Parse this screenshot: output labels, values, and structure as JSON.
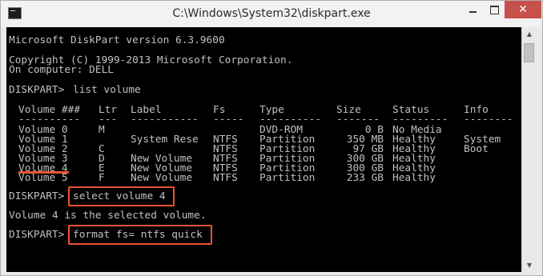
{
  "window": {
    "title": "C:\\Windows\\System32\\diskpart.exe",
    "icon": "console-app-icon",
    "controls": {
      "minimize": "minimize",
      "maximize": "maximize",
      "close": "✕"
    }
  },
  "console": {
    "version_line": "Microsoft DiskPart version 6.3.9600",
    "copyright_line": "Copyright (C) 1999-2013 Microsoft Corporation.",
    "computer_line": "On computer: DELL",
    "prompt": "DISKPART>",
    "command1": "list volume",
    "table": {
      "headers": [
        "Volume ###",
        "Ltr",
        "Label",
        "Fs",
        "Type",
        "Size",
        "Status",
        "Info"
      ],
      "separators": [
        "----------",
        "---",
        "-----------",
        "-----",
        "----------",
        "-------",
        "---------",
        "--------"
      ],
      "rows": [
        [
          "Volume 0",
          "M",
          "",
          "",
          "DVD-ROM",
          "0 B",
          "No Media",
          ""
        ],
        [
          "Volume 1",
          "",
          "System Rese",
          "NTFS",
          "Partition",
          "350 MB",
          "Healthy",
          "System"
        ],
        [
          "Volume 2",
          "C",
          "",
          "NTFS",
          "Partition",
          "97 GB",
          "Healthy",
          "Boot"
        ],
        [
          "Volume 3",
          "D",
          "New Volume",
          "NTFS",
          "Partition",
          "300 GB",
          "Healthy",
          ""
        ],
        [
          "Volume 4",
          "E",
          "New Volume",
          "NTFS",
          "Partition",
          "300 GB",
          "Healthy",
          ""
        ],
        [
          "Volume 5",
          "F",
          "New Volume",
          "NTFS",
          "Partition",
          "233 GB",
          "Healthy",
          ""
        ]
      ]
    },
    "command2": "select volume 4",
    "response2": "Volume 4 is the selected volume.",
    "command3": "format fs= ntfs quick"
  },
  "colors": {
    "console_bg": "#000000",
    "console_text": "#c0c0c0",
    "highlight": "#e8542f",
    "close_button": "#c7504a"
  }
}
